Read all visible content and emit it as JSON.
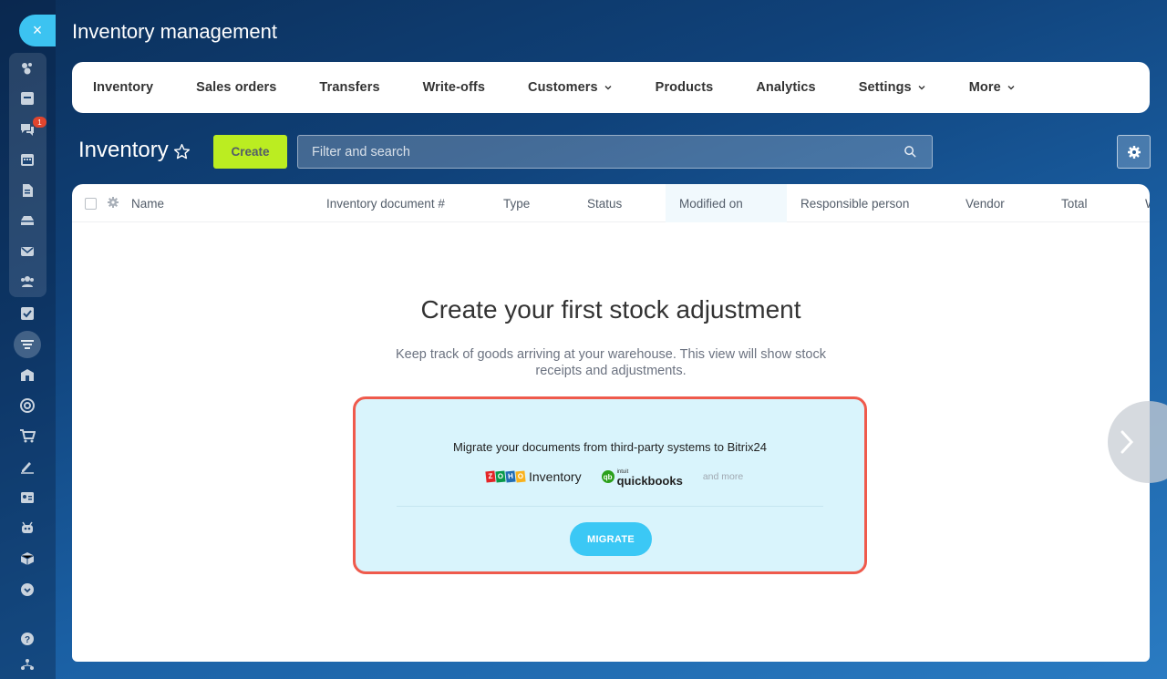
{
  "app": {
    "title": "Inventory management"
  },
  "sidebar": {
    "close_symbol": "×",
    "badge_count": "1",
    "icons": [
      "pie-chart-icon",
      "feed-icon",
      "chat-icon",
      "calendar-icon",
      "document-icon",
      "drive-icon",
      "mail-icon",
      "people-icon",
      "tasks-icon",
      "crm-filter-icon",
      "store-icon",
      "target-icon",
      "cart-icon",
      "sign-icon",
      "contact-card-icon",
      "robot-icon",
      "box-icon",
      "more-icon",
      "help-icon",
      "structure-icon"
    ]
  },
  "nav": {
    "items": [
      {
        "label": "Inventory",
        "dropdown": false
      },
      {
        "label": "Sales orders",
        "dropdown": false
      },
      {
        "label": "Transfers",
        "dropdown": false
      },
      {
        "label": "Write-offs",
        "dropdown": false
      },
      {
        "label": "Customers",
        "dropdown": true
      },
      {
        "label": "Products",
        "dropdown": false
      },
      {
        "label": "Analytics",
        "dropdown": false
      },
      {
        "label": "Settings",
        "dropdown": true
      },
      {
        "label": "More",
        "dropdown": true
      }
    ]
  },
  "toolbar": {
    "title": "Inventory",
    "create_label": "Create",
    "search_placeholder": "Filter and search"
  },
  "table": {
    "columns": [
      "Name",
      "Inventory document #",
      "Type",
      "Status",
      "Modified on",
      "Responsible person",
      "Vendor",
      "Total",
      "W"
    ]
  },
  "empty_state": {
    "title": "Create your first stock adjustment",
    "subtitle": "Keep track of goods arriving at your warehouse. This view will show stock receipts and adjustments."
  },
  "migrate": {
    "text": "Migrate your documents from third-party systems to Bitrix24",
    "zoho_letters": [
      "Z",
      "O",
      "H",
      "O"
    ],
    "zoho_label": "Inventory",
    "qb_intuit": "intuit",
    "qb_label": "quickbooks",
    "qb_mark": "qb",
    "and_more": "and more",
    "button_label": "MIGRATE"
  },
  "colors": {
    "accent_create": "#bbed21",
    "migrate_button": "#3bc8f5",
    "card_bg": "#d9f4fc",
    "card_border": "#ef5a4c"
  }
}
